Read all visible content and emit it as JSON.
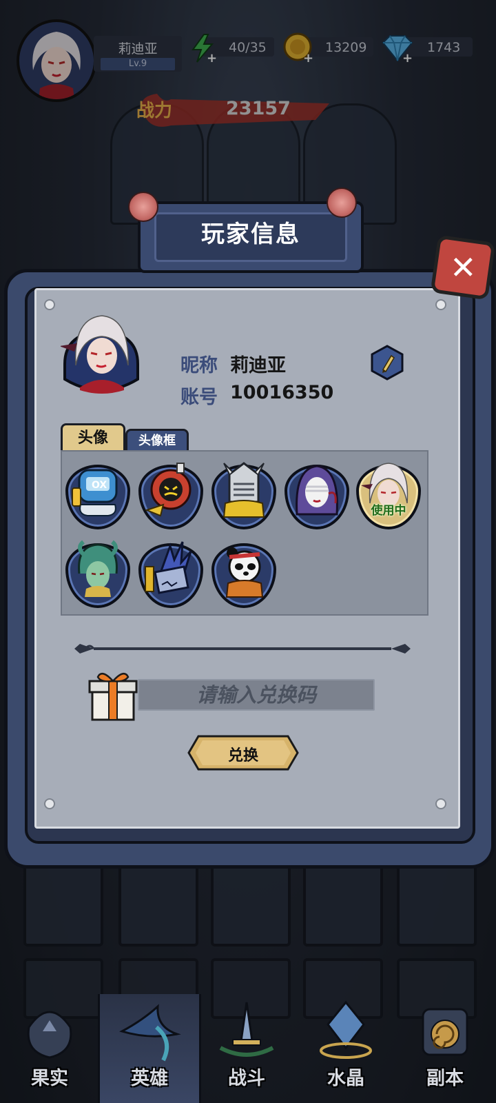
{
  "hud": {
    "player_name": "莉迪亚",
    "level": "Lv.9",
    "energy": "40/35",
    "gold": "13209",
    "diamonds": "1743",
    "power_label": "战力",
    "power_value": "23157"
  },
  "modal": {
    "title": "玩家信息",
    "nickname_label": "昵称",
    "nickname_value": "莉迪亚",
    "account_label": "账号",
    "account_value": "10016350",
    "tabs": [
      {
        "label": "头像",
        "active": true
      },
      {
        "label": "头像框",
        "active": false
      }
    ],
    "avatars": [
      {
        "icon": "robot-diver-avatar-icon",
        "in_use": false
      },
      {
        "icon": "submarine-bot-avatar-icon",
        "in_use": false
      },
      {
        "icon": "armored-knight-avatar-icon",
        "in_use": false
      },
      {
        "icon": "hooded-nun-avatar-icon",
        "in_use": false
      },
      {
        "icon": "white-haired-lady-avatar-icon",
        "in_use": true,
        "badge": "使用中"
      },
      {
        "icon": "medusa-avatar-icon",
        "in_use": false
      },
      {
        "icon": "blue-dragon-avatar-icon",
        "in_use": false
      },
      {
        "icon": "panda-warrior-avatar-icon",
        "in_use": false
      }
    ],
    "redeem_placeholder": "请输入兑换码",
    "redeem_button": "兑换"
  },
  "bottom_nav": [
    {
      "label": "果实",
      "active": false
    },
    {
      "label": "英雄",
      "active": true
    },
    {
      "label": "战斗",
      "active": false
    },
    {
      "label": "水晶",
      "active": false
    },
    {
      "label": "副本",
      "active": false
    }
  ],
  "colors": {
    "accent_gold": "#e1c98c",
    "close_red": "#c0463f",
    "label_blue": "#3b4c7a",
    "frame_blue": "#3b4a6c"
  }
}
